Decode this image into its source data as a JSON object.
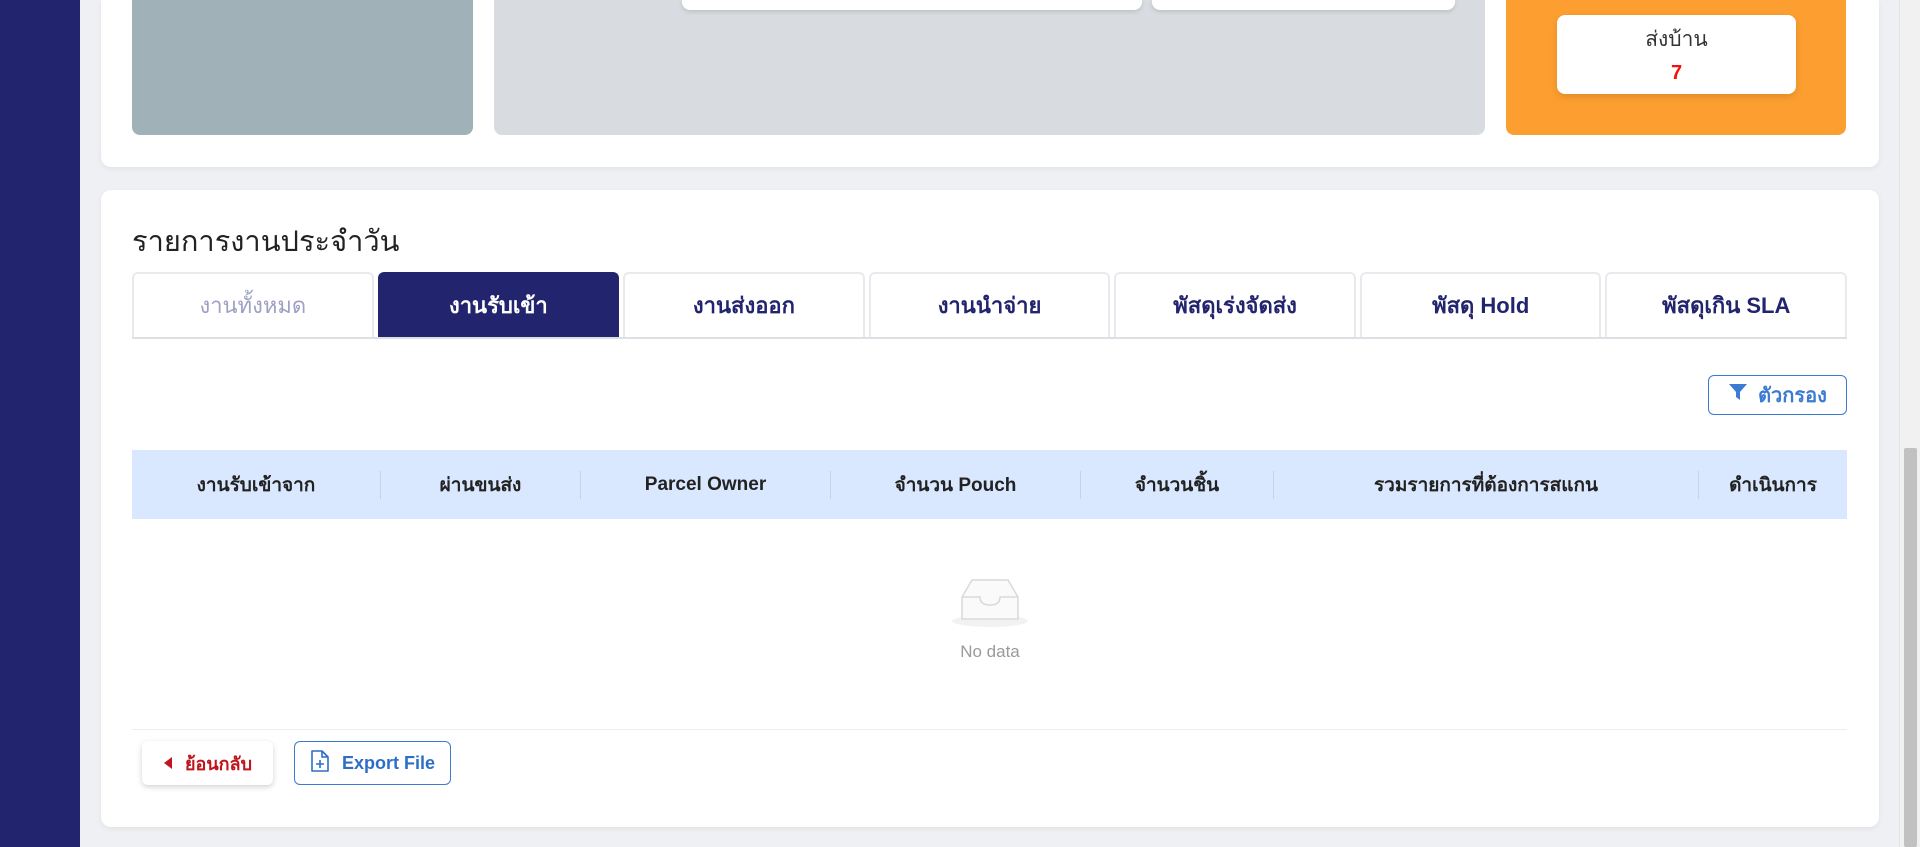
{
  "summary": {
    "stat_card": {
      "label": "ส่งบ้าน",
      "value": "7"
    }
  },
  "section": {
    "title": "รายการงานประจำวัน"
  },
  "tabs": [
    {
      "label": "งานทั้งหมด"
    },
    {
      "label": "งานรับเข้า"
    },
    {
      "label": "งานส่งออก"
    },
    {
      "label": "งานนำจ่าย"
    },
    {
      "label": "พัสดุเร่งจัดส่ง"
    },
    {
      "label": "พัสดุ Hold"
    },
    {
      "label": "พัสดุเกิน SLA"
    }
  ],
  "active_tab": "งานรับเข้า",
  "filter": {
    "label": "ตัวกรอง",
    "icon": "filter-icon"
  },
  "table": {
    "columns": [
      "งานรับเข้าจาก",
      "ผ่านขนส่ง",
      "Parcel Owner",
      "จำนวน Pouch",
      "จำนวนชิ้น",
      "รวมรายการที่ต้องการสแกน",
      "ดำเนินการ"
    ],
    "rows": [],
    "empty_text": "No data"
  },
  "actions": {
    "back_label": "ย้อนกลับ",
    "export_label": "Export File"
  },
  "colors": {
    "sidebar": "#23246e",
    "accent": "#23246e",
    "orange_panel": "#fd9f30",
    "stat_value": "#f50f0f",
    "table_header": "#d9e8fe",
    "link_blue": "#3b7bd1",
    "back_red": "#c0151d"
  }
}
